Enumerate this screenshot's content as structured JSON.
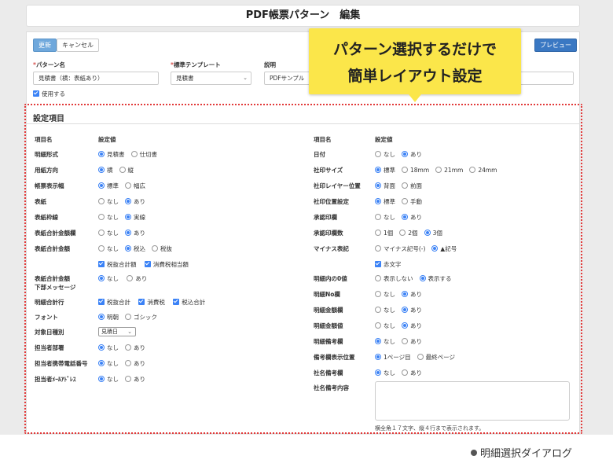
{
  "header": {
    "title": "PDF帳票パターン　編集"
  },
  "toolbar": {
    "update_label": "更新",
    "cancel_label": "キャンセル",
    "preview_label": "プレビュー"
  },
  "form": {
    "pattern_name_label": "パターン名",
    "pattern_name_value": "見積書（横：表紙あり）",
    "template_label": "標準テンプレート",
    "template_value": "見積書",
    "description_label": "説明",
    "description_value": "PDFサンプル",
    "use_label": "使用する"
  },
  "section": {
    "title": "設定項目",
    "col_item": "項目名",
    "col_value": "設定値"
  },
  "left_rows": [
    {
      "label": "明細形式",
      "options": [
        {
          "text": "見積書",
          "on": true
        },
        {
          "text": "仕切書",
          "on": false
        }
      ]
    },
    {
      "label": "用紙方向",
      "options": [
        {
          "text": "横",
          "on": true
        },
        {
          "text": "縦",
          "on": false
        }
      ]
    },
    {
      "label": "帳票表示幅",
      "options": [
        {
          "text": "標準",
          "on": true
        },
        {
          "text": "幅広",
          "on": false
        }
      ]
    },
    {
      "label": "表紙",
      "options": [
        {
          "text": "なし",
          "on": false
        },
        {
          "text": "あり",
          "on": true
        }
      ]
    },
    {
      "label": "表紙枠線",
      "options": [
        {
          "text": "なし",
          "on": false
        },
        {
          "text": "実線",
          "on": true
        }
      ]
    },
    {
      "label": "表紙合計金額欄",
      "options": [
        {
          "text": "なし",
          "on": false
        },
        {
          "text": "あり",
          "on": true
        }
      ]
    },
    {
      "label": "表紙合計金額",
      "options": [
        {
          "text": "なし",
          "on": false
        },
        {
          "text": "税込",
          "on": true
        },
        {
          "text": "税抜",
          "on": false
        }
      ]
    }
  ],
  "left_checks_1": [
    "税抜合計額",
    "消費税相当額"
  ],
  "cover_message": {
    "label1": "表紙合計金額",
    "label2": "下部メッセージ",
    "options": [
      {
        "text": "なし",
        "on": true
      },
      {
        "text": "あり",
        "on": false
      }
    ]
  },
  "detail_total": {
    "label": "明細合計行",
    "checks": [
      "税抜合計",
      "消費税",
      "税込合計"
    ]
  },
  "left_rows_2": [
    {
      "label": "フォント",
      "options": [
        {
          "text": "明朝",
          "on": true
        },
        {
          "text": "ゴシック",
          "on": false
        }
      ]
    }
  ],
  "date_type": {
    "label": "対象日種別",
    "value": "見積日"
  },
  "left_rows_3": [
    {
      "label": "担当者部署",
      "options": [
        {
          "text": "なし",
          "on": true
        },
        {
          "text": "あり",
          "on": false
        }
      ]
    },
    {
      "label": "担当者携帯電話番号",
      "options": [
        {
          "text": "なし",
          "on": true
        },
        {
          "text": "あり",
          "on": false
        }
      ]
    },
    {
      "label": "担当者ﾒｰﾙｱﾄﾞﾚｽ",
      "options": [
        {
          "text": "なし",
          "on": true
        },
        {
          "text": "あり",
          "on": false
        }
      ]
    }
  ],
  "right_rows": [
    {
      "label": "日付",
      "options": [
        {
          "text": "なし",
          "on": false
        },
        {
          "text": "あり",
          "on": true
        }
      ]
    },
    {
      "label": "社印サイズ",
      "options": [
        {
          "text": "標準",
          "on": true
        },
        {
          "text": "18mm",
          "on": false
        },
        {
          "text": "21mm",
          "on": false
        },
        {
          "text": "24mm",
          "on": false
        }
      ]
    },
    {
      "label": "社印レイヤー位置",
      "options": [
        {
          "text": "背面",
          "on": true
        },
        {
          "text": "前面",
          "on": false
        }
      ]
    },
    {
      "label": "社印位置設定",
      "options": [
        {
          "text": "標準",
          "on": true
        },
        {
          "text": "手動",
          "on": false
        }
      ]
    },
    {
      "label": "承認印欄",
      "options": [
        {
          "text": "なし",
          "on": false
        },
        {
          "text": "あり",
          "on": true
        }
      ]
    },
    {
      "label": "承認印欄数",
      "options": [
        {
          "text": "1個",
          "on": false
        },
        {
          "text": "2個",
          "on": false
        },
        {
          "text": "3個",
          "on": true
        }
      ]
    },
    {
      "label": "マイナス表記",
      "options": [
        {
          "text": "マイナス記号(-)",
          "on": false
        },
        {
          "text": "▲記号",
          "on": true
        }
      ]
    }
  ],
  "red_text_label": "赤文字",
  "right_rows_2": [
    {
      "label": "明細内の0値",
      "options": [
        {
          "text": "表示しない",
          "on": false
        },
        {
          "text": "表示する",
          "on": true
        }
      ]
    },
    {
      "label": "明細No欄",
      "options": [
        {
          "text": "なし",
          "on": false
        },
        {
          "text": "あり",
          "on": true
        }
      ]
    },
    {
      "label": "明細金額欄",
      "options": [
        {
          "text": "なし",
          "on": false
        },
        {
          "text": "あり",
          "on": true
        }
      ]
    },
    {
      "label": "明細金額値",
      "options": [
        {
          "text": "なし",
          "on": false
        },
        {
          "text": "あり",
          "on": true
        }
      ]
    },
    {
      "label": "明細備考欄",
      "options": [
        {
          "text": "なし",
          "on": true
        },
        {
          "text": "あり",
          "on": false
        }
      ]
    },
    {
      "label": "備考欄表示位置",
      "options": [
        {
          "text": "1ページ目",
          "on": true
        },
        {
          "text": "最終ページ",
          "on": false
        }
      ]
    },
    {
      "label": "社名備考欄",
      "options": [
        {
          "text": "なし",
          "on": true
        },
        {
          "text": "あり",
          "on": false
        }
      ]
    }
  ],
  "remark_label": "社名備考内容",
  "remark_note": "横全角１７文字、縦４行まで表示されます。",
  "callout": {
    "line1": "パターン選択するだけで",
    "line2": "簡単レイアウト設定"
  },
  "caption": "明細選択ダイアログ"
}
